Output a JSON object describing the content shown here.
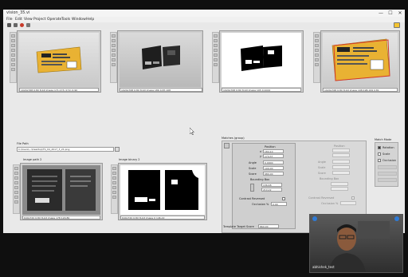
{
  "window": {
    "title": "vision_35.vi",
    "minimize": "—",
    "maximize": "☐",
    "close": "✕"
  },
  "menu": [
    "File",
    "Edit",
    "View",
    "Project",
    "Operate",
    "Tools",
    "Window",
    "Help"
  ],
  "top_images": [
    {
      "status": "1024x768 0.8X 8-bit image 171,173 (171)  0.90"
    },
    {
      "status": "1024x768 0.8X 8-bit image 186  0,87,108"
    },
    {
      "status": "1024x768 0.8X 8-bit image 195   0,1024"
    },
    {
      "status": "1024x768 0.8X 8-bit image 198,198,199   0.81"
    }
  ],
  "file_path": {
    "label": "File Path",
    "value": "C:\\Users\\...\\Desktop\\TS_04_2017_3_21.png"
  },
  "bottom_images": [
    {
      "label": "Image path 2",
      "status": "640x720 0.8X 8-bit image 178  120,80"
    },
    {
      "label": "Image binary 2",
      "status": "640x720 0.8X 8-bit image 0  146,22"
    }
  ],
  "match_panel": {
    "title": "Matches (group)",
    "position_label": "Position",
    "x": "184.10",
    "y": "174.37",
    "angle_label": "Angle",
    "angle": "0.0000",
    "scale_label": "Scale",
    "scale": "100.00",
    "score_label": "Score",
    "score": "980.00",
    "bbox_label": "Bounding Box",
    "bbox_1": "136.48",
    "bbox_2": "210.22",
    "contrast_reversed_label": "Contrast Reversed",
    "occlusion_label": "Occlusion %",
    "occlusion": "0.00",
    "template_score_label": "Template Target Score",
    "template_score": "860.00"
  },
  "match_panel_ghost": {
    "position_label": "Position",
    "angle_label": "Angle",
    "scale_label": "Scale",
    "score_label": "Score",
    "bbox_label": "Bounding Box",
    "contrast_reversed_label": "Contrast Reversed",
    "occlusion_label": "Occlusion %"
  },
  "search_mode": {
    "title": "Match Mode",
    "options": [
      {
        "label": "Rotation",
        "checked": true
      },
      {
        "label": "Scale",
        "checked": false
      },
      {
        "label": "Occlusion",
        "checked": false
      }
    ]
  },
  "video": {
    "caption": "abhishek_test"
  },
  "colors": {
    "label_yellow": "#e9b233",
    "taskbar": "#1c2230",
    "accent_blue": "#2f7bd6"
  }
}
